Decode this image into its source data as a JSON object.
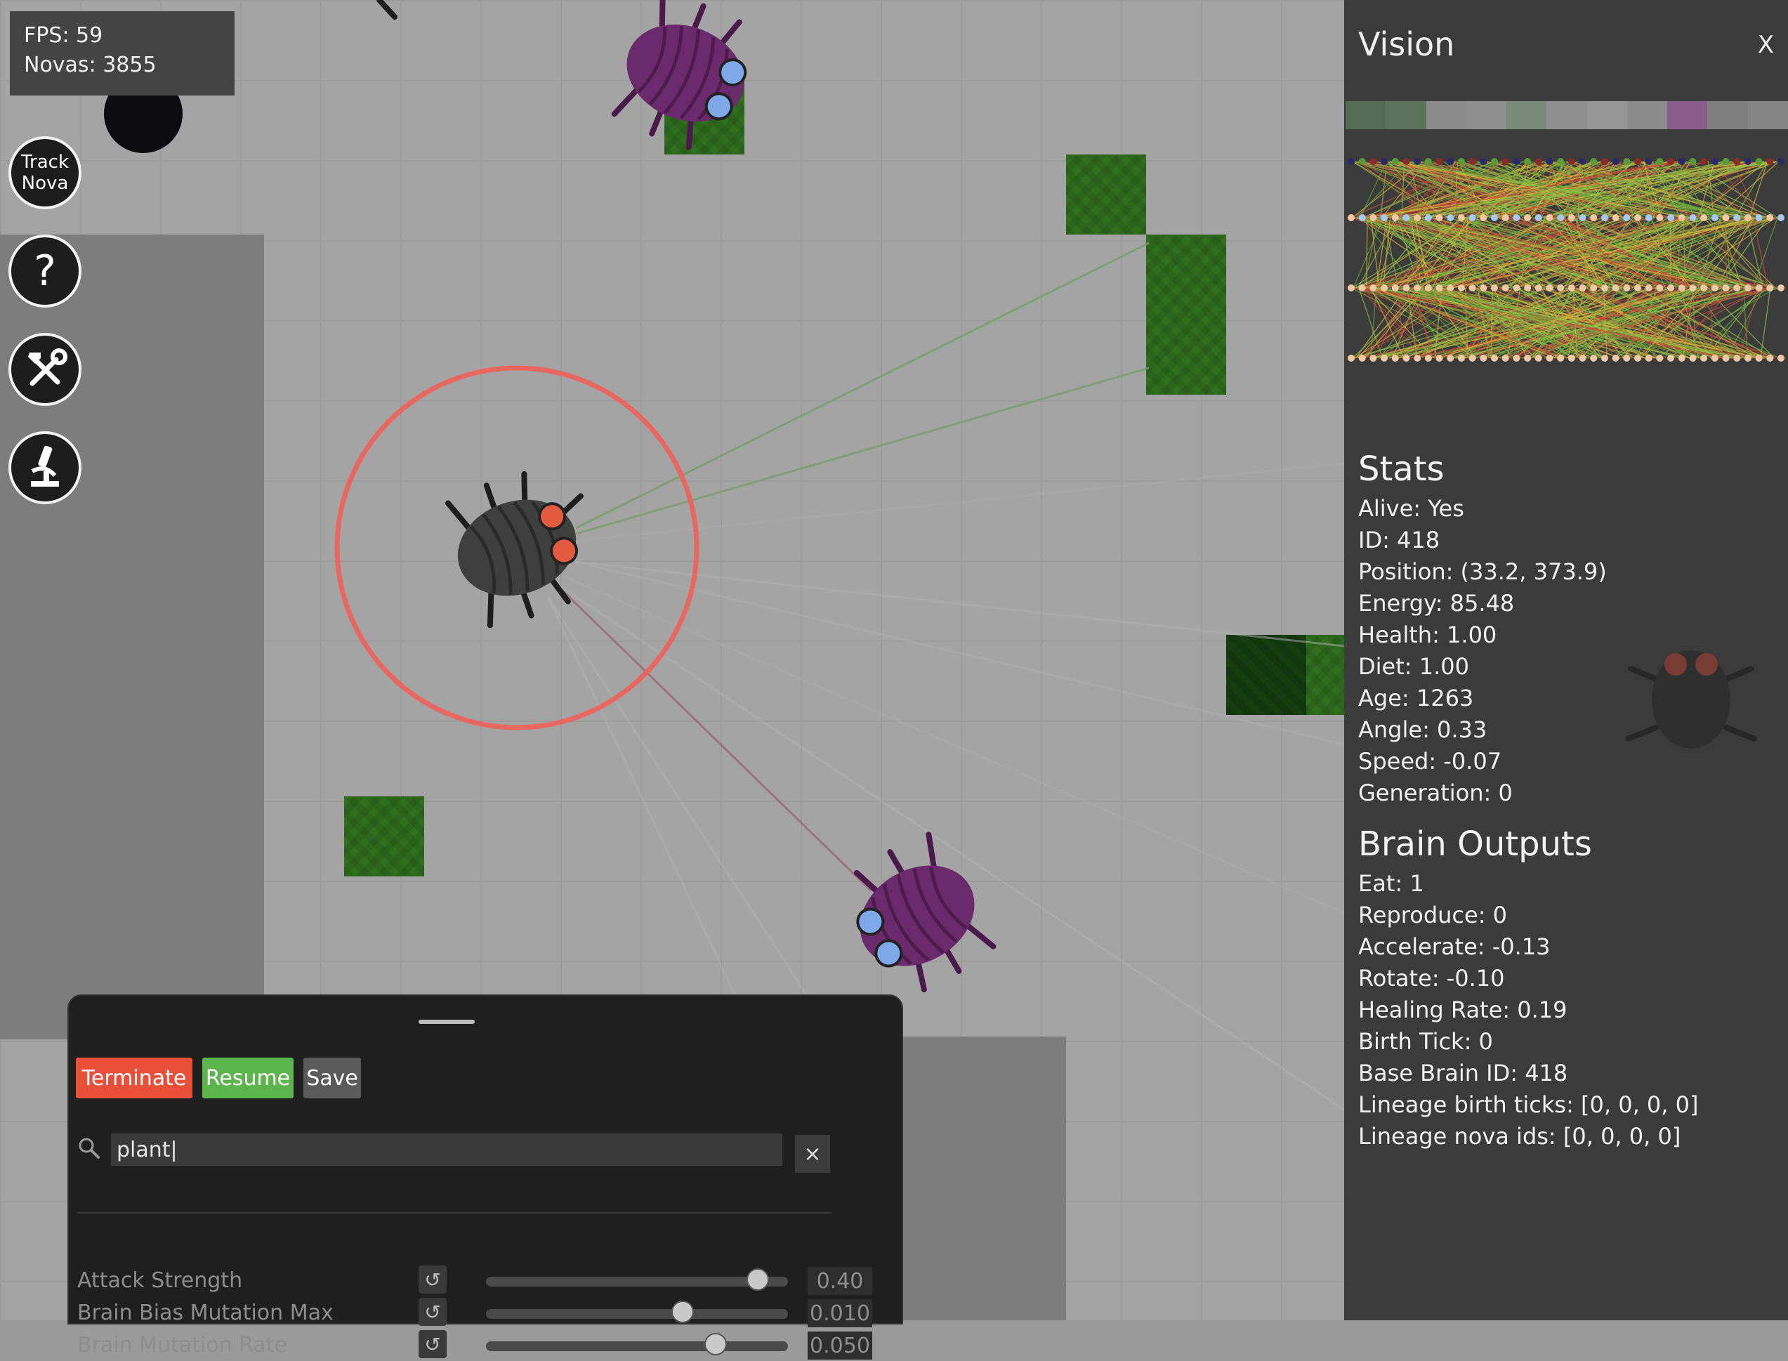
{
  "hud": {
    "fps": "FPS: 59",
    "novas": "Novas: 3855"
  },
  "sidebar": {
    "track_nova": [
      "Track",
      "Nova"
    ],
    "help_label": "?"
  },
  "vision_panel": {
    "title": "Vision",
    "close_label": "X",
    "vision_colors": [
      "#566b55",
      "#5d725c",
      "#8c8c8c",
      "#8f8f8f",
      "#7a8a79",
      "#8f8f8f",
      "#969696",
      "#8c8c8c",
      "#8a5d8a",
      "#7f7f7f",
      "#858585"
    ],
    "network_layer_colors": [
      "#cfcfcf",
      "#a9c7f5",
      "#f3c6a5",
      "#f3c6a5"
    ],
    "stats_title": "Stats",
    "stats": [
      "Alive: Yes",
      "ID: 418",
      "Position: (33.2, 373.9)",
      "Energy: 85.48",
      "Health: 1.00",
      "Diet: 1.00",
      "Age: 1263",
      "Angle: 0.33",
      "Speed: -0.07",
      "Generation: 0"
    ],
    "brain_title": "Brain Outputs",
    "brain_outputs": [
      "Eat: 1",
      "Reproduce: 0",
      "Accelerate: -0.13",
      "Rotate: -0.10",
      "Healing Rate: 0.19",
      "Birth Tick: 0",
      "Base Brain ID: 418",
      "Lineage birth ticks: [0, 0, 0, 0]",
      "Lineage nova ids: [0, 0, 0, 0]"
    ]
  },
  "controls": {
    "terminate_label": "Terminate",
    "resume_label": "Resume",
    "save_label": "Save",
    "search_value": "plant|",
    "clear_label": "×",
    "params": [
      {
        "label": "Attack Strength",
        "value": "0.40",
        "slider_fraction": 0.9
      },
      {
        "label": "Brain Bias Mutation Max",
        "value": "0.010",
        "slider_fraction": 0.65
      },
      {
        "label": "Brain Mutation Rate",
        "value": "0.050",
        "slider_fraction": 0.76
      }
    ],
    "reset_glyph": "↺"
  },
  "colors": {
    "terminate": "#e8503a",
    "resume": "#5bb44c",
    "save": "#5a5a5a",
    "selection_ring": "#f0625a",
    "nova_purple": "#6b2a6b",
    "nova_dark": "#3c3c3c"
  }
}
